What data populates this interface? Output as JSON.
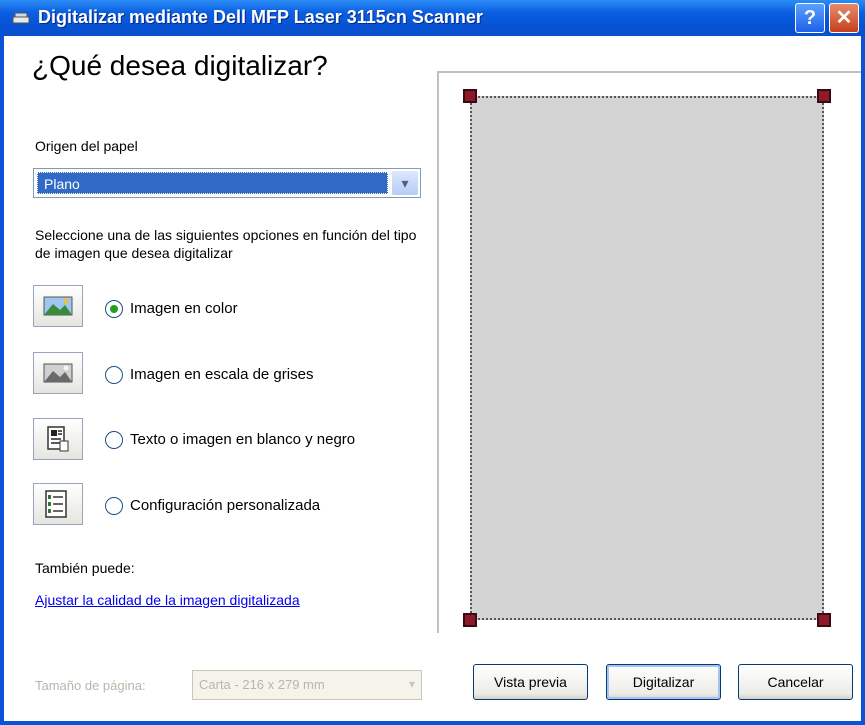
{
  "window": {
    "title": "Digitalizar mediante Dell MFP Laser 3115cn Scanner",
    "help_glyph": "?",
    "close_glyph": "✕"
  },
  "heading": "¿Qué desea digitalizar?",
  "paper_source": {
    "label": "Origen del papel",
    "value": "Plano"
  },
  "instructions": "Seleccione una de las siguientes opciones en función del tipo de imagen que desea digitalizar",
  "options": [
    {
      "label": "Imagen en color",
      "icon": "color-photo-icon",
      "checked": true
    },
    {
      "label": "Imagen en escala de grises",
      "icon": "grayscale-photo-icon",
      "checked": false
    },
    {
      "label": "Texto o imagen en blanco y negro",
      "icon": "bw-text-icon",
      "checked": false
    },
    {
      "label": "Configuración personalizada",
      "icon": "custom-settings-icon",
      "checked": false
    }
  ],
  "also": {
    "label": "También puede:",
    "link": "Ajustar la calidad de la imagen digitalizada"
  },
  "page_size": {
    "label": "Tamaño de página:",
    "value": "Carta - 216 x 279 mm"
  },
  "buttons": {
    "preview": "Vista previa",
    "scan": "Digitalizar",
    "cancel": "Cancelar"
  },
  "colors": {
    "titlebar": "#0653d6",
    "selection": "#316ac5",
    "crop_handle": "#8b1a2b"
  }
}
